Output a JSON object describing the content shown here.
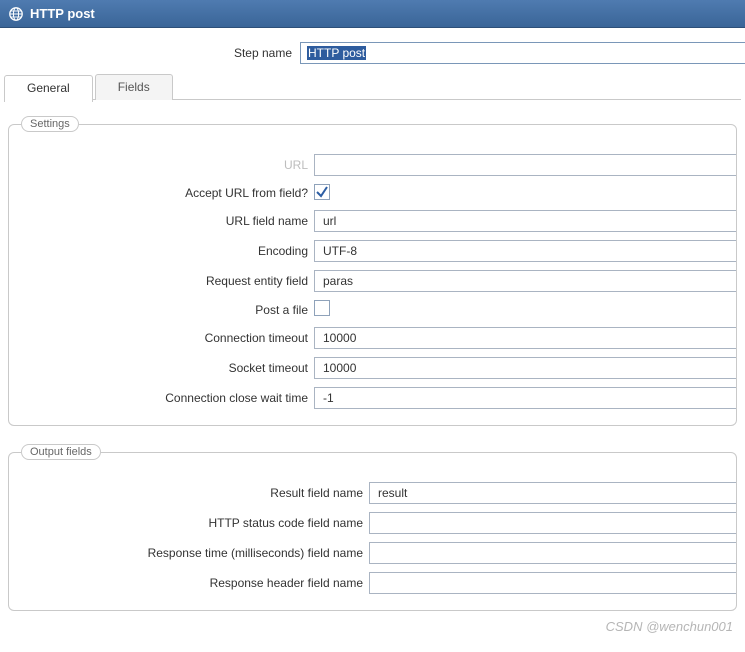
{
  "titlebar": {
    "title": "HTTP post"
  },
  "step_name": {
    "label": "Step name",
    "value": "HTTP post"
  },
  "tabs": {
    "general": "General",
    "fields": "Fields"
  },
  "groups": {
    "settings": {
      "legend": "Settings",
      "url": {
        "label": "URL",
        "value": ""
      },
      "accept_url_from_field": {
        "label": "Accept URL from field?",
        "checked": true
      },
      "url_field_name": {
        "label": "URL field name",
        "value": "url"
      },
      "encoding": {
        "label": "Encoding",
        "value": "UTF-8"
      },
      "request_entity_field": {
        "label": "Request entity field",
        "value": "paras"
      },
      "post_a_file": {
        "label": "Post a file",
        "checked": false
      },
      "connection_timeout": {
        "label": "Connection timeout",
        "value": "10000"
      },
      "socket_timeout": {
        "label": "Socket timeout",
        "value": "10000"
      },
      "connection_close_wait": {
        "label": "Connection close wait time",
        "value": "-1"
      }
    },
    "output_fields": {
      "legend": "Output fields",
      "result_field_name": {
        "label": "Result field name",
        "value": "result"
      },
      "http_status_code_field_name": {
        "label": "HTTP status code field name",
        "value": ""
      },
      "response_time_field_name": {
        "label": "Response time (milliseconds) field name",
        "value": ""
      },
      "response_header_field_name": {
        "label": "Response header field name",
        "value": ""
      }
    }
  },
  "watermark": "CSDN @wenchun001"
}
